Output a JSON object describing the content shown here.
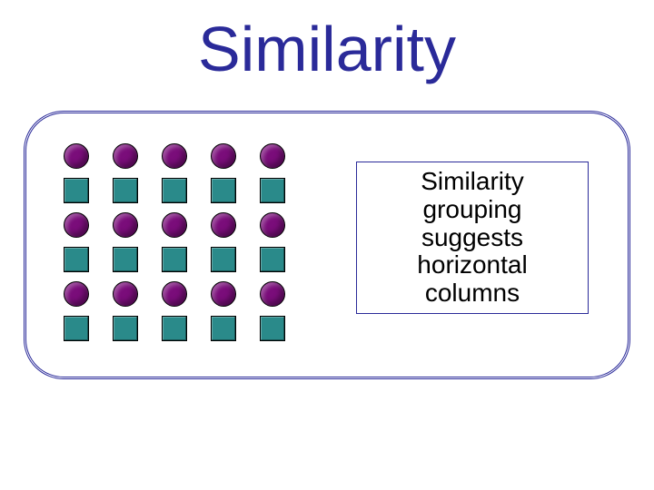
{
  "title": "Similarity",
  "caption": "Similarity\ngrouping\nsuggests\nhorizontal\ncolumns",
  "grid": {
    "rows": 6,
    "cols": 5,
    "pattern": [
      "circle",
      "square",
      "circle",
      "square",
      "circle",
      "square"
    ]
  },
  "colors": {
    "title": "#2a2a99",
    "border": "#2a2a99",
    "circle": "#7a0d7a",
    "square": "#2a8a8a"
  }
}
